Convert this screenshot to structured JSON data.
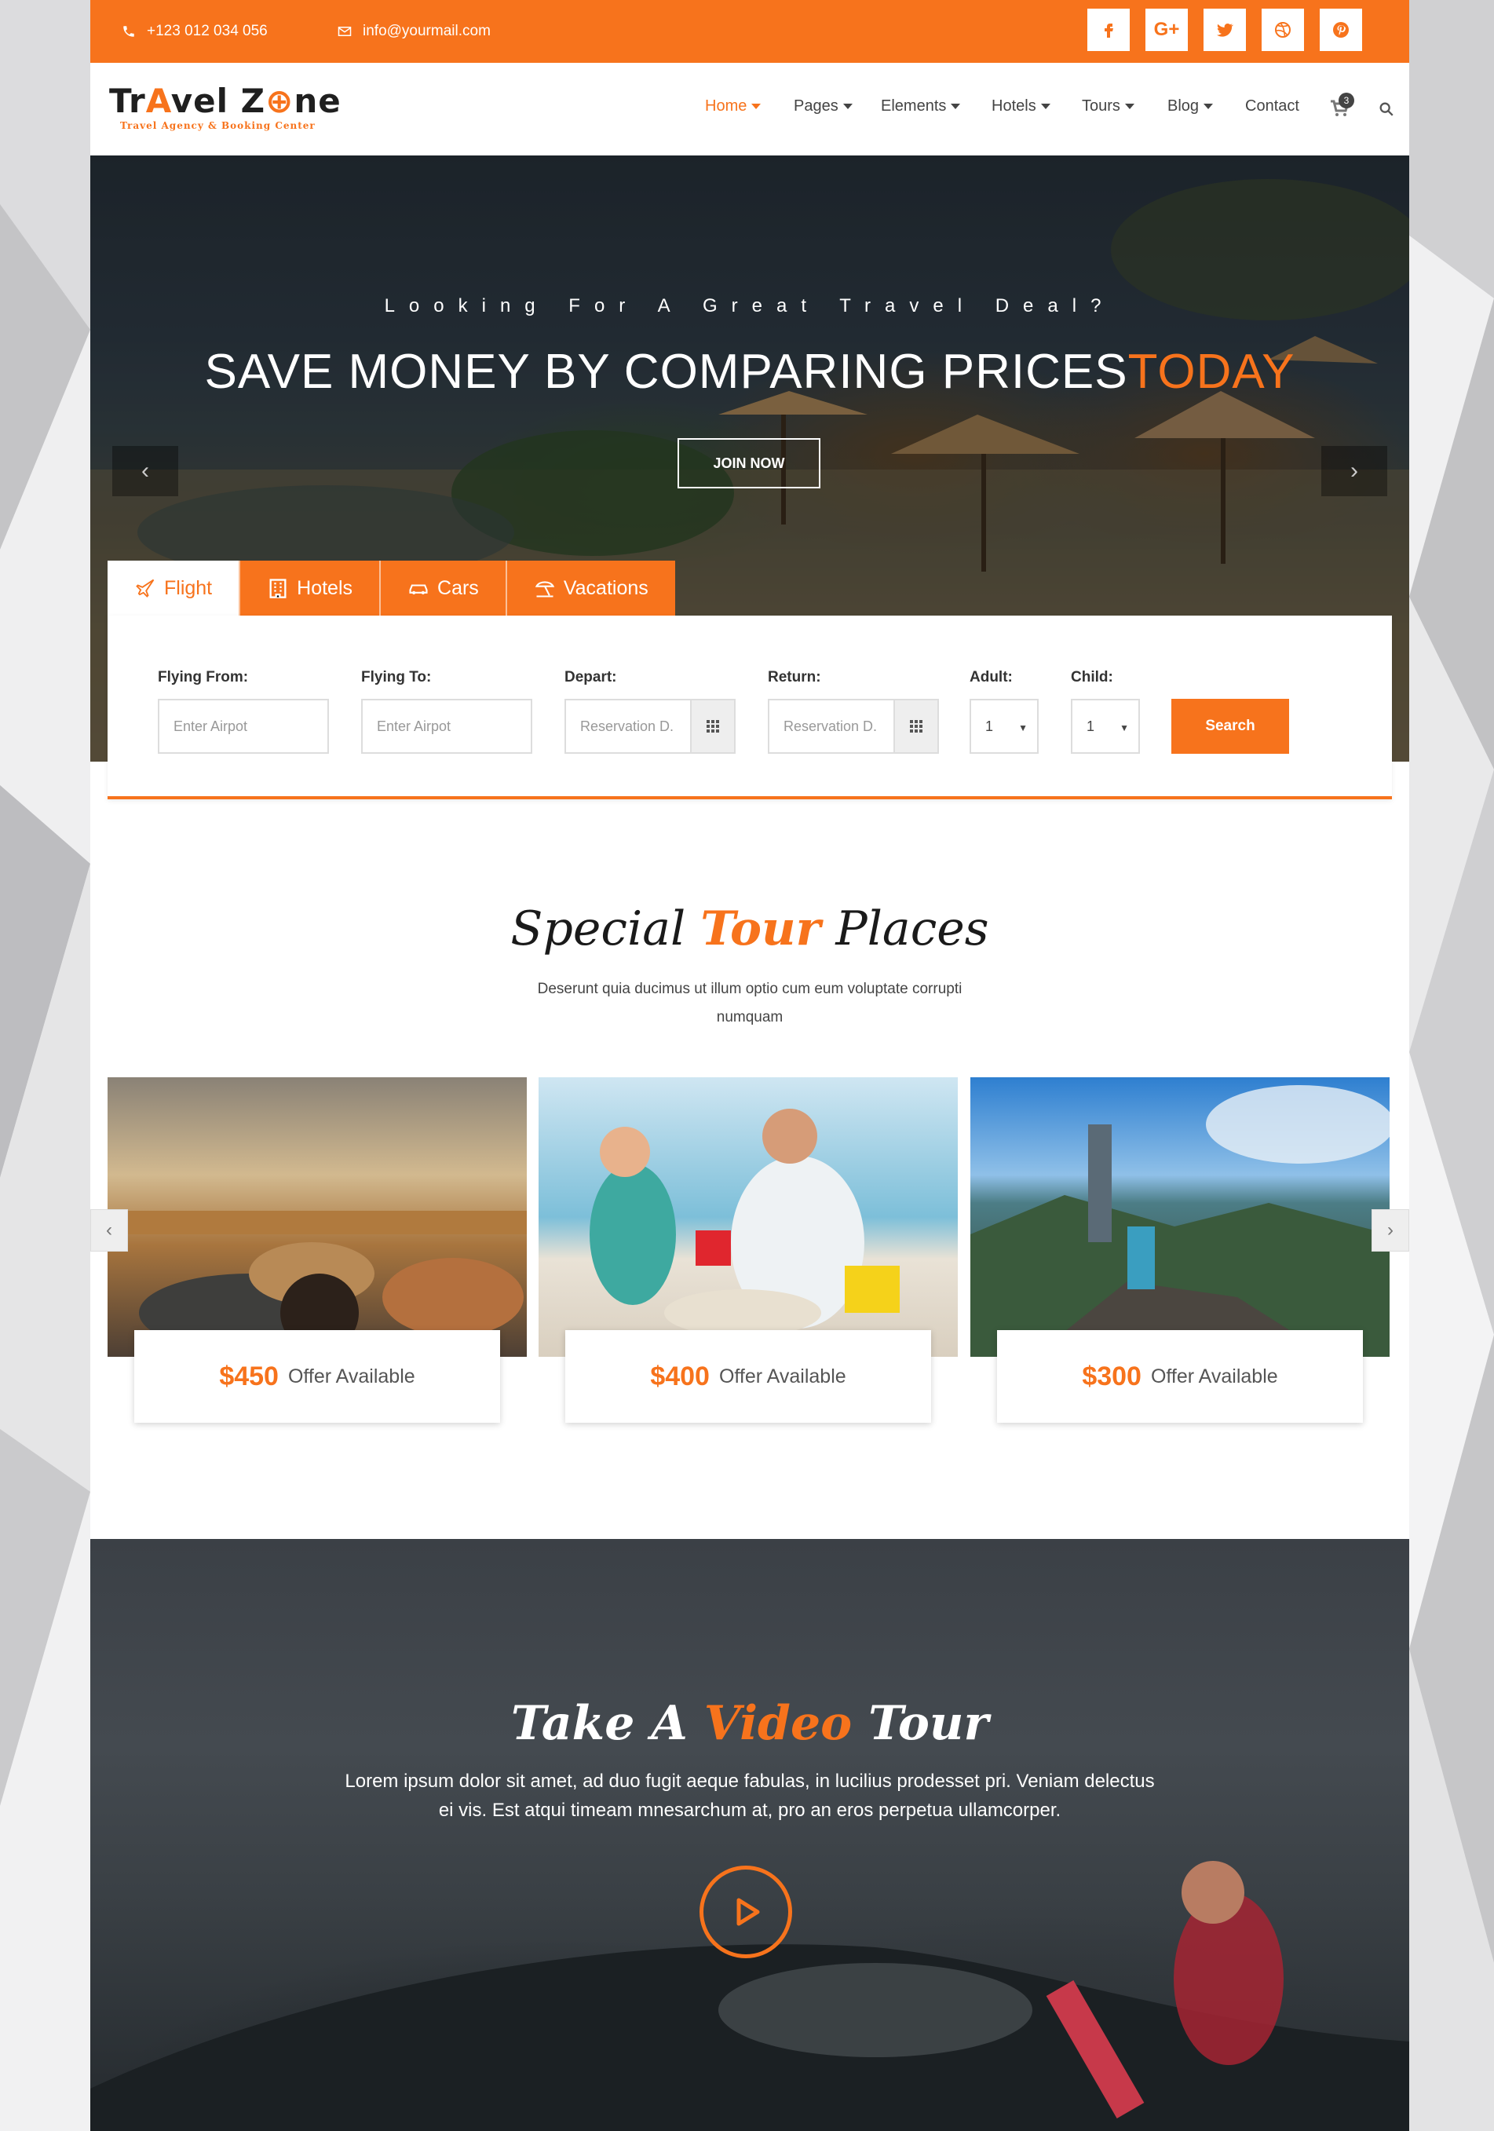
{
  "topbar": {
    "phone": "+123 012 034 056",
    "email": "info@yourmail.com",
    "social": [
      "facebook-icon",
      "google-plus-icon",
      "twitter-icon",
      "dribbble-icon",
      "pinterest-icon"
    ]
  },
  "logo": {
    "title_a": "Tr",
    "title_b": "vel Z",
    "title_c": "ne",
    "subtitle": "Travel Agency & Booking Center"
  },
  "nav": {
    "items": [
      {
        "label": "Home"
      },
      {
        "label": "Pages"
      },
      {
        "label": "Elements"
      },
      {
        "label": "Hotels"
      },
      {
        "label": "Tours"
      },
      {
        "label": "Blog"
      },
      {
        "label": "Contact"
      }
    ],
    "cart_count": "3"
  },
  "hero": {
    "pretitle": "Looking For A Great Travel Deal?",
    "title_main": "SAVE MONEY BY COMPARING PRICES",
    "title_highlight": "TODAY",
    "button": "JOIN NOW",
    "prev": "‹",
    "next": "›"
  },
  "search": {
    "tabs": [
      "Flight",
      "Hotels",
      "Cars",
      "Vacations"
    ],
    "fields": {
      "from_label": "Flying From:",
      "from_placeholder": "Enter Airpot",
      "to_label": "Flying To:",
      "to_placeholder": "Enter Airpot",
      "depart_label": "Depart:",
      "depart_placeholder": "Reservation D.",
      "return_label": "Return:",
      "return_placeholder": "Reservation D.",
      "adult_label": "Adult:",
      "adult_value": "1",
      "child_label": "Child:",
      "child_value": "1"
    },
    "button": "Search"
  },
  "tours": {
    "title_a": "Special",
    "title_b": "Tour",
    "title_c": "Places",
    "subtitle": "Deserunt quia ducimus ut illum optio cum eum voluptate corrupti numquam",
    "cards": [
      {
        "price": "$450",
        "text": "Offer Available"
      },
      {
        "price": "$400",
        "text": "Offer Available"
      },
      {
        "price": "$300",
        "text": "Offer Available"
      }
    ],
    "prev": "‹",
    "next": "›"
  },
  "video": {
    "title_a": "Take A",
    "title_b": "Video",
    "title_c": "Tour",
    "text": "Lorem ipsum dolor sit amet, ad duo fugit aeque fabulas, in lucilius prodesset pri. Veniam delectus ei vis. Est atqui timeam mnesarchum at, pro an eros perpetua ullamcorper."
  },
  "colors": {
    "accent": "#f7731c",
    "dark": "#1f1f1f"
  }
}
